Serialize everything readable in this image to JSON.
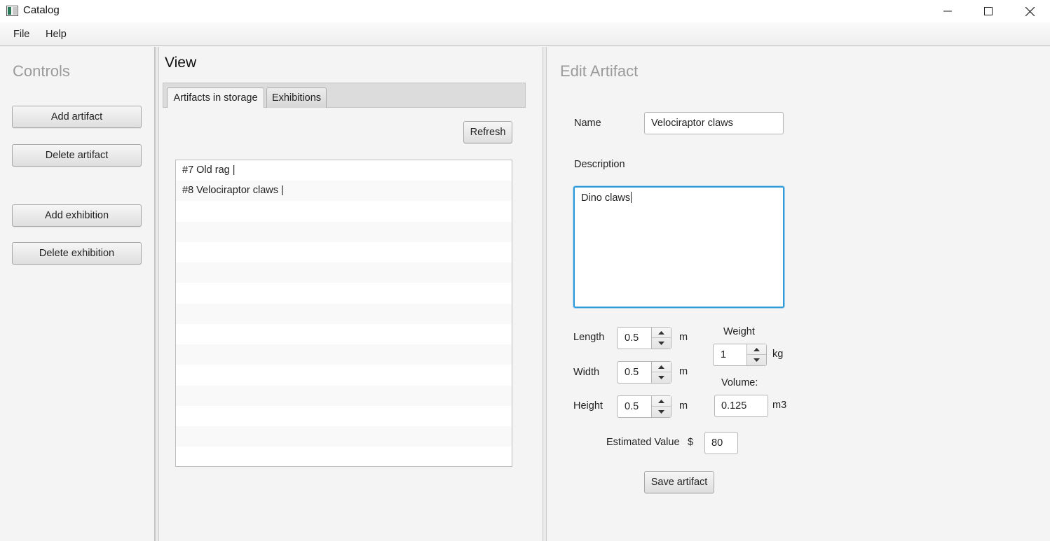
{
  "window": {
    "title": "Catalog",
    "icon": "app-icon",
    "controls": [
      "minimize-icon",
      "maximize-icon",
      "close-icon"
    ]
  },
  "menubar": {
    "items": [
      {
        "label": "File"
      },
      {
        "label": "Help"
      }
    ]
  },
  "controls": {
    "heading": "Controls",
    "buttons": {
      "add_artifact": "Add artifact",
      "delete_artifact": "Delete artifact",
      "add_exhibition": "Add exhibition",
      "delete_exhibition": "Delete exhibition"
    }
  },
  "view": {
    "heading": "View",
    "tabs": [
      {
        "label": "Artifacts in storage",
        "selected": true
      },
      {
        "label": "Exhibitions",
        "selected": false
      }
    ],
    "refresh_label": "Refresh",
    "items": [
      {
        "text": "#7 Old rag |"
      },
      {
        "text": "#8 Velociraptor claws |"
      }
    ]
  },
  "editor": {
    "heading": "Edit Artifact",
    "name_label": "Name",
    "name_value": "Velociraptor claws",
    "description_label": "Description",
    "description_value": "Dino claws",
    "length": {
      "label": "Length",
      "value": "0.5",
      "unit": "m"
    },
    "width": {
      "label": "Width",
      "value": "0.5",
      "unit": "m"
    },
    "height": {
      "label": "Height",
      "value": "0.5",
      "unit": "m"
    },
    "weight": {
      "label": "Weight",
      "value": "1",
      "unit": "kg"
    },
    "volume": {
      "label": "Volume:",
      "value": "0.125",
      "unit": "m3"
    },
    "estimated_value": {
      "label": "Estimated Value",
      "currency": "$",
      "value": "80"
    },
    "save_label": "Save artifact"
  },
  "colors": {
    "focus_border": "#2f9bd8",
    "heading_gray": "#9a9a9a",
    "panel_bg": "#f4f4f4"
  }
}
